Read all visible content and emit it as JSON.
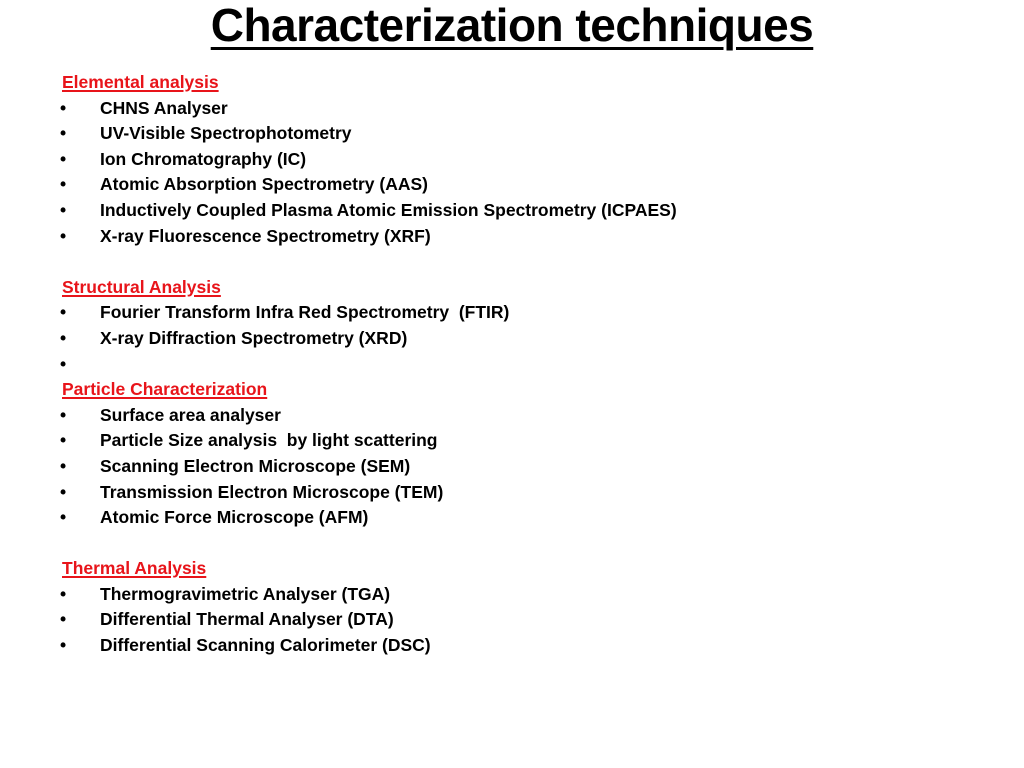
{
  "title": "Characterization techniques",
  "colors": {
    "heading": "#e8141a",
    "text": "#000000",
    "background": "#ffffff"
  },
  "bullet_glyph": "•",
  "sections": [
    {
      "heading": "Elemental analysis",
      "items": [
        "CHNS Analyser",
        "UV-Visible Spectrophotometry",
        "Ion Chromatography (IC)",
        "Atomic Absorption Spectrometry (AAS)",
        "Inductively Coupled Plasma Atomic Emission Spectrometry (ICPAES)",
        "X-ray Fluorescence Spectrometry (XRF)"
      ]
    },
    {
      "heading": "Structural Analysis",
      "items": [
        "Fourier Transform Infra Red Spectrometry  (FTIR)",
        "X-ray Diffraction Spectrometry (XRD)",
        ""
      ]
    },
    {
      "heading": "Particle Characterization",
      "items": [
        "Surface area analyser",
        "Particle Size analysis  by light scattering",
        "Scanning Electron Microscope (SEM)",
        "Transmission Electron Microscope (TEM)",
        "Atomic Force Microscope (AFM)"
      ]
    },
    {
      "heading": "Thermal Analysis",
      "items": [
        "Thermogravimetric Analyser (TGA)",
        "Differential Thermal Analyser (DTA)",
        "Differential Scanning Calorimeter (DSC)"
      ]
    }
  ]
}
